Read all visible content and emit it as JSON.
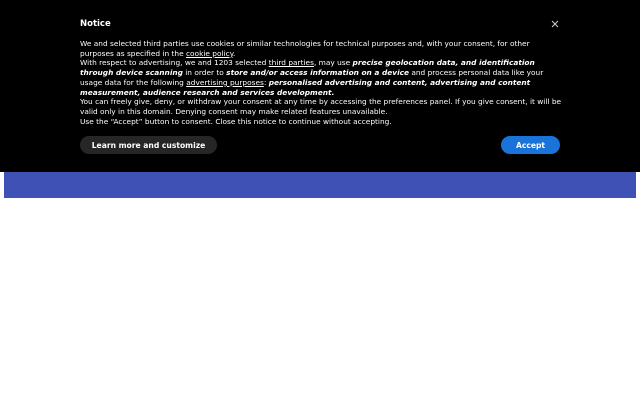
{
  "notice": {
    "title": "Notice",
    "para1_a": "We and selected third parties use cookies or similar technologies for technical purposes and, with your consent, for other purposes as specified in the ",
    "cookie_policy_link": "cookie policy",
    "para1_b": ".",
    "para2_a": "With respect to advertising, we and 1203 selected ",
    "third_parties_link": "third parties",
    "para2_b": ", may use ",
    "para2_bold1": "precise geolocation data, and identification through device scanning",
    "para2_c": " in order to ",
    "para2_bold2": "store and/or access information on a device",
    "para2_d": " and process personal data like your usage data for the following ",
    "advertising_purposes_link": "advertising purposes",
    "para2_e": ": ",
    "para2_bold3": "personalised advertising and content, advertising and content measurement, audience research and services development.",
    "para3": "You can freely give, deny, or withdraw your consent at any time by accessing the preferences panel. If you give consent, it will be valid only in this domain. Denying consent may make related features unavailable.",
    "para4": "Use the “Accept” button to consent. Close this notice to continue without accepting.",
    "learn_more_label": "Learn more and customize",
    "accept_label": "Accept",
    "close_icon": "close-icon"
  },
  "colors": {
    "notice_bg": "#000000",
    "banner": "#3f51b5",
    "accept": "#1a73d9",
    "learn_more": "#262626"
  }
}
